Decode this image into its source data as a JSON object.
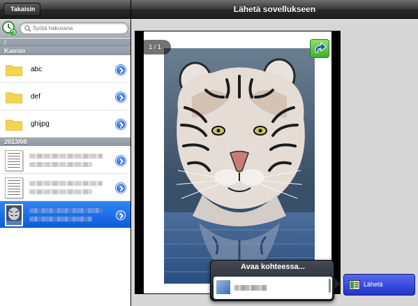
{
  "left_pane": {
    "back_label": "Takaisin",
    "search_placeholder": "Syötä hakusana",
    "path": "/",
    "folder_section": "Kansio",
    "folders": [
      {
        "name": "abc"
      },
      {
        "name": "def"
      },
      {
        "name": "ghijpg"
      }
    ],
    "date_section": "2013/08",
    "files": [
      {
        "thumbnail": "document",
        "selected": false
      },
      {
        "thumbnail": "document",
        "selected": false
      },
      {
        "thumbnail": "tiger-image",
        "selected": true
      }
    ]
  },
  "right_pane": {
    "title": "Lähetä sovellukseen",
    "page_counter": "1 / 1",
    "open_in": {
      "title": "Avaa kohteessa..."
    },
    "send_button_label": "Lähetä"
  },
  "colors": {
    "nav_bar": "#2a2a2a",
    "selection_blue": "#1a6ee6",
    "section_header": "#97a0ab",
    "send_button": "#3344dd",
    "rotate_button": "#56c03f"
  },
  "icons": {
    "history": "clock-refresh-icon",
    "search": "magnifier-icon",
    "folder": "folder-icon",
    "disclosure": "chevron-right-circle-icon",
    "rotate": "rotate-icon",
    "send": "send-app-icon"
  }
}
